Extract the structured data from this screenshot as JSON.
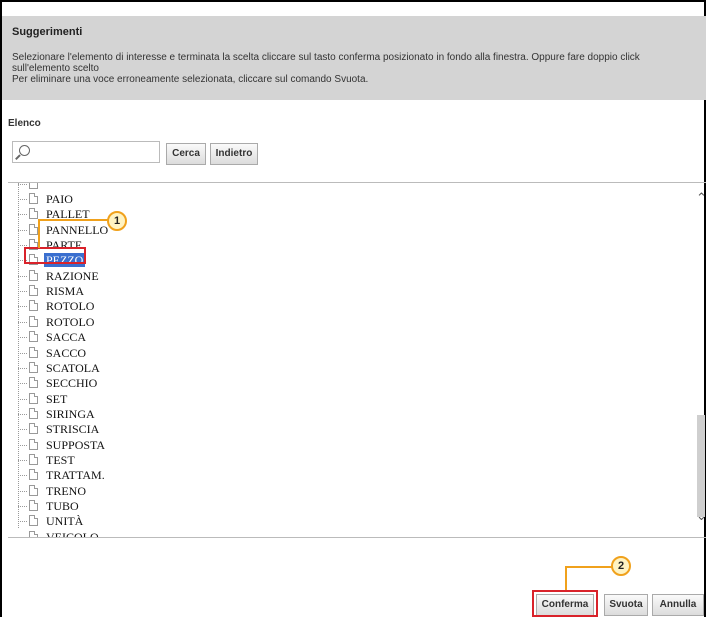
{
  "suggestions": {
    "title": "Suggerimenti",
    "line1": "Selezionare l'elemento di interesse e terminata la scelta cliccare sul tasto conferma posizionato in fondo alla finestra. Oppure fare doppio click",
    "line2": "sull'elemento scelto",
    "line3": "Per eliminare una voce erroneamente selezionata, cliccare sul comando Svuota."
  },
  "list_title": "Elenco",
  "search": {
    "placeholder": "",
    "value": ""
  },
  "buttons": {
    "search": "Cerca",
    "back": "Indietro",
    "confirm": "Conferma",
    "clear": "Svuota",
    "cancel": "Annulla"
  },
  "items": [
    "PAIO",
    "PALLET",
    "PANNELLO",
    "PARTE",
    "PEZZO",
    "RAZIONE",
    "RISMA",
    "ROTOLO",
    "ROTOLO",
    "SACCA",
    "SACCO",
    "SCATOLA",
    "SECCHIO",
    "SET",
    "SIRINGA",
    "STRISCIA",
    "SUPPOSTA",
    "TEST",
    "TRATTAM.",
    "TRENO",
    "TUBO",
    "UNITÀ",
    "VEICOLO"
  ],
  "selected_item": "PEZZO",
  "callouts": {
    "one": "1",
    "two": "2"
  },
  "colors": {
    "selection": "#3a6fcf",
    "highlight_border": "#d9222a",
    "callout": "#f0a11c",
    "panel": "#d4d4d4"
  }
}
